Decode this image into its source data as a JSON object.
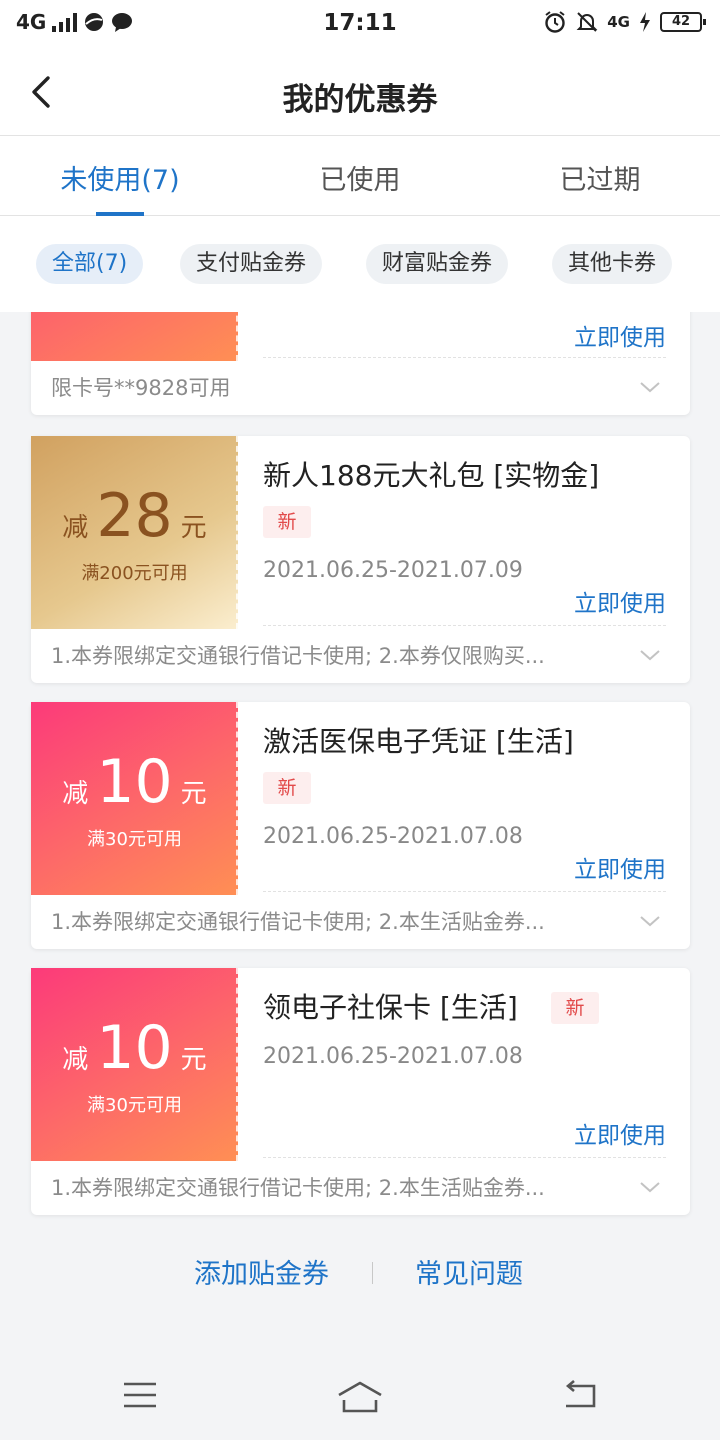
{
  "status_bar": {
    "network": "4G",
    "time": "17:11",
    "network_right": "4G",
    "battery": "42"
  },
  "header": {
    "title": "我的优惠券"
  },
  "tabs": [
    {
      "label": "未使用(7)"
    },
    {
      "label": "已使用"
    },
    {
      "label": "已过期"
    }
  ],
  "filters": [
    {
      "label": "全部(7)"
    },
    {
      "label": "支付贴金券"
    },
    {
      "label": "财富贴金券"
    },
    {
      "label": "其他卡券"
    }
  ],
  "coupons": [
    {
      "use_label": "立即使用",
      "rule": "限卡号**9828可用"
    },
    {
      "title": "新人188元大礼包  [实物金]",
      "badge": "新",
      "amount_prefix": "减",
      "amount": "28",
      "amount_unit": "元",
      "condition": "满200元可用",
      "date": "2021.06.25-2021.07.09",
      "use_label": "立即使用",
      "rule": "1.本券限绑定交通银行借记卡使用; 2.本券仅限购买...",
      "theme": "gold"
    },
    {
      "title": "激活医保电子凭证  [生活]",
      "badge": "新",
      "amount_prefix": "减",
      "amount": "10",
      "amount_unit": "元",
      "condition": "满30元可用",
      "date": "2021.06.25-2021.07.08",
      "use_label": "立即使用",
      "rule": "1.本券限绑定交通银行借记卡使用; 2.本生活贴金券...",
      "theme": "pink"
    },
    {
      "title": "领电子社保卡  [生活]",
      "badge": "新",
      "amount_prefix": "减",
      "amount": "10",
      "amount_unit": "元",
      "condition": "满30元可用",
      "date": "2021.06.25-2021.07.08",
      "use_label": "立即使用",
      "rule": "1.本券限绑定交通银行借记卡使用; 2.本生活贴金券...",
      "theme": "pink"
    }
  ],
  "links": {
    "add": "添加贴金券",
    "faq": "常见问题"
  },
  "colors": {
    "accent": "#1f74c8",
    "badge_red": "#e24b4b",
    "pink_start": "#fc3a7a",
    "pink_end": "#ff8f54",
    "gold_start": "#d1a160"
  }
}
